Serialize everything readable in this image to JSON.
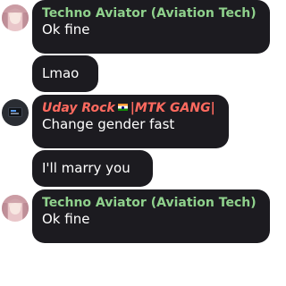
{
  "messages": [
    {
      "sender": "Techno Aviator (Aviation Tech)",
      "text": "Ok fine",
      "avatar": "anime-girl-avatar",
      "sender_color": "#8fd18c"
    },
    {
      "sender": null,
      "text": "Lmao"
    },
    {
      "sender_name": "Uday Rock",
      "sender_suffix": "|MTK GANG|",
      "text": "Change gender fast",
      "avatar": "computer-avatar",
      "sender_color": "#ff6a5f"
    },
    {
      "sender": null,
      "text": "I'll marry you"
    },
    {
      "sender": "Techno Aviator (Aviation Tech)",
      "text": "Ok fine",
      "avatar": "anime-girl-avatar",
      "sender_color": "#8fd18c"
    }
  ],
  "colors": {
    "bubble": "#1c1b20",
    "text": "#ffffff",
    "background": "#ffffff"
  }
}
